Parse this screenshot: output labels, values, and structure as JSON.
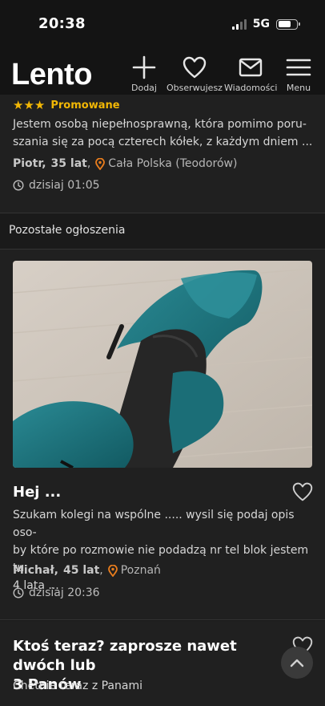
{
  "status": {
    "time": "20:38",
    "network": "5G"
  },
  "app": {
    "logo": "Lento"
  },
  "nav": [
    {
      "label": "Dodaj",
      "icon": "plus-icon"
    },
    {
      "label": "Obserwujesz",
      "icon": "heart-icon"
    },
    {
      "label": "Wiadomości",
      "icon": "envelope-icon"
    },
    {
      "label": "Menu",
      "icon": "hamburger-icon"
    }
  ],
  "promoted": {
    "stars": "★★★",
    "badge": "Promowane",
    "description_line1": "Jestem osobą niepełnosprawną, która pomimo poru-",
    "description_line2": "szania się za pocą czterech kółek, z każdym dniem ...",
    "name": "Piotr,",
    "age": "35 lat",
    "location": "Cała Polska (Teodorów)",
    "date": "dzisiaj 01:05"
  },
  "section": {
    "title": "Pozostałe ogłoszenia"
  },
  "listings": [
    {
      "title": "Hej ...",
      "description_line1": "Szukam kolegi na wspólne ..... wysil się podaj opis oso-",
      "description_line2": "by które po rozmowie nie podadzą nr tel blok jestem tu",
      "description_line3": "4 lata ...",
      "name": "Michał,",
      "age": "45 lat",
      "location": "Poznań",
      "date": "dzisiaj 20:36"
    },
    {
      "title_line1": "Ktoś teraz? zaprosze nawet dwóch lub",
      "title_line2": "3 Panów",
      "description": "Chetnie teraz z Panami"
    }
  ],
  "colors": {
    "accent": "#f2b705",
    "location_pin": "#e97d1d",
    "background": "#1a1a1a",
    "card": "#202020"
  }
}
